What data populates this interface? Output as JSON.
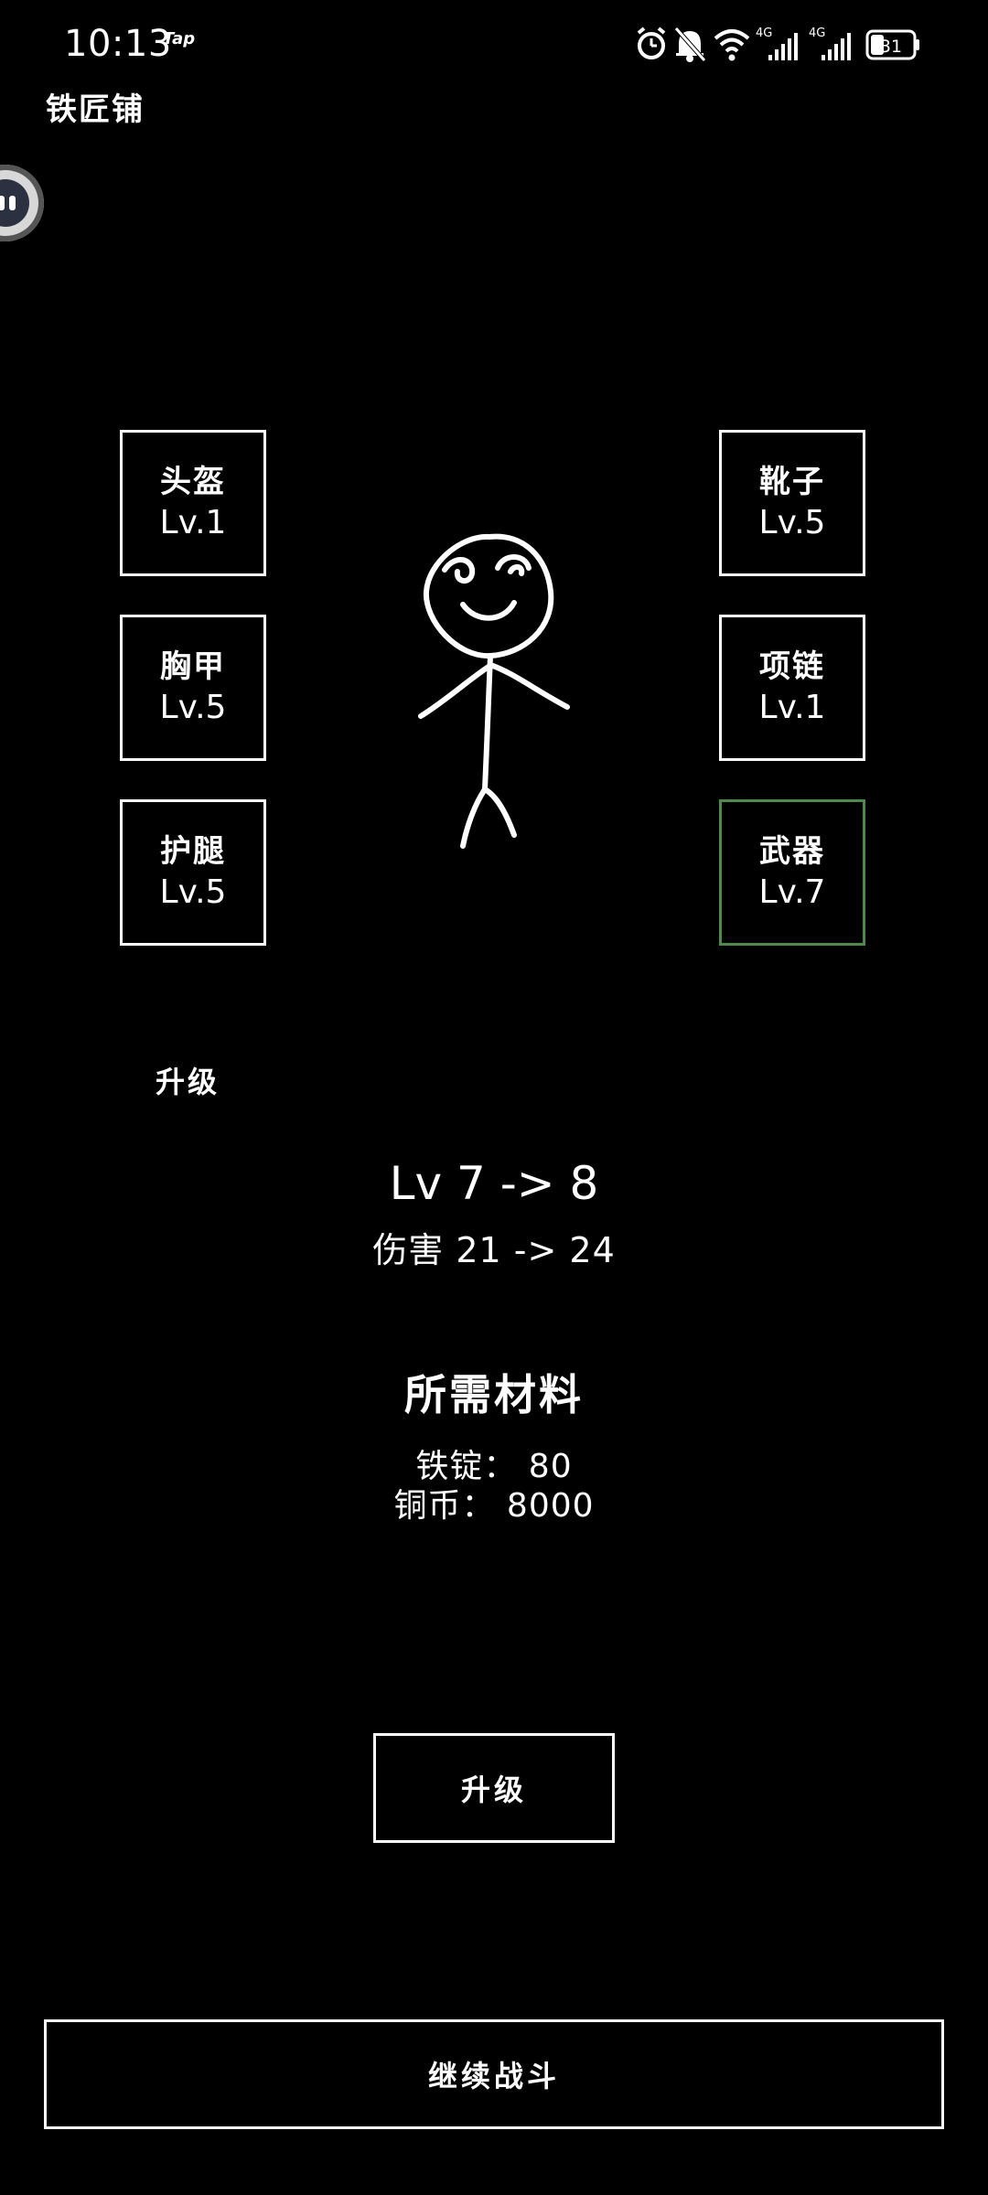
{
  "status_bar": {
    "time": "10:13",
    "carrier_badge": "Tap",
    "network_1": "4G",
    "network_2": "4G",
    "battery": "31",
    "icons": [
      "alarm-icon",
      "mute-bell-icon",
      "wifi-icon",
      "signal-icon",
      "signal-icon",
      "battery-icon"
    ]
  },
  "header": {
    "title": "铁匠铺"
  },
  "slots": {
    "helmet": {
      "name": "头盔",
      "level": "Lv.1"
    },
    "chest": {
      "name": "胸甲",
      "level": "Lv.5"
    },
    "legs": {
      "name": "护腿",
      "level": "Lv.5"
    },
    "boots": {
      "name": "靴子",
      "level": "Lv.5"
    },
    "necklace": {
      "name": "项链",
      "level": "Lv.1"
    },
    "weapon": {
      "name": "武器",
      "level": "Lv.7",
      "selected": true
    }
  },
  "upgrade": {
    "section_label": "升级",
    "level_change": "Lv 7 -> 8",
    "stat_change": "伤害 21 -> 24",
    "materials_title": "所需材料",
    "materials": [
      {
        "text": "铁锭： 80"
      },
      {
        "text": "铜币： 8000"
      }
    ],
    "button_label": "升级"
  },
  "footer": {
    "continue_label": "继续战斗"
  },
  "colors": {
    "background": "#000000",
    "foreground": "#ffffff",
    "selected_border": "#4f8a4b"
  }
}
